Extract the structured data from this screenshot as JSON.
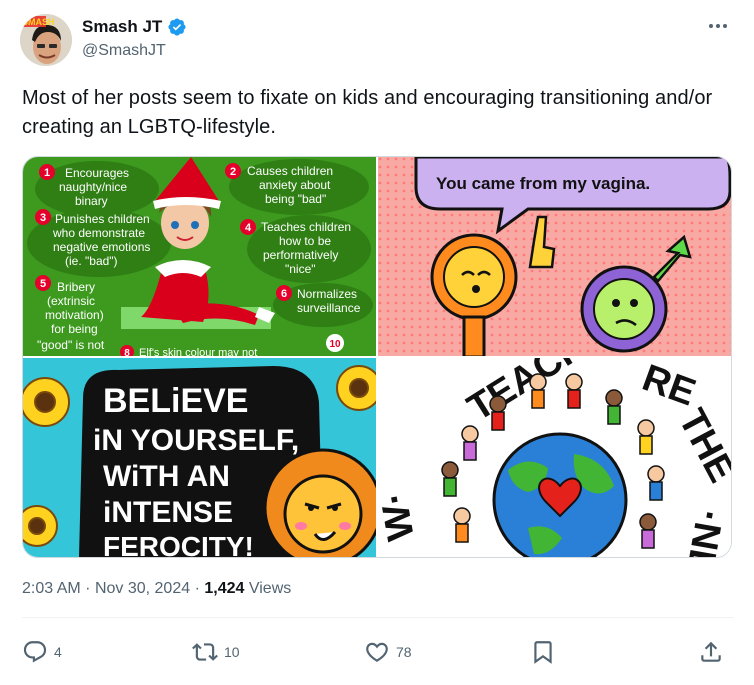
{
  "author": {
    "display_name": "Smash JT",
    "handle": "@SmashJT",
    "avatar_text": "SMASH",
    "verified_color": "#1d9bf0"
  },
  "tweet": {
    "text": "Most of her posts seem to fixate on kids and encouraging transitioning and/or creating an LGBTQ-lifestyle."
  },
  "media": {
    "top_left": {
      "items": [
        {
          "num": "1",
          "text": "Encourages\nnaughty/nice\nbinary"
        },
        {
          "num": "2",
          "text": "Causes children\nanxiety about\nbeing \"bad\""
        },
        {
          "num": "3",
          "text": "Punishes children\nwho demonstrate\nnegative emotions\n(ie. \"bad\")"
        },
        {
          "num": "4",
          "text": "Teaches children\nhow to be\nperformatively\n\"nice\""
        },
        {
          "num": "5",
          "text": "Bribery\n(extrinsic\nmotivation)\nfor being\n\"good\" is not"
        },
        {
          "num": "6",
          "text": "Normalizes\nsurveillance"
        },
        {
          "num": "8",
          "text": "Elf's skin colour may not"
        },
        {
          "num": "10",
          "text": ""
        }
      ]
    },
    "top_right": {
      "speech": "You came from my vagina."
    },
    "bottom_left": {
      "lines": [
        "BELiEVE",
        "iN YOURSELF,",
        "WiTH AN",
        "iNTENSE",
        "FEROCITY!"
      ]
    },
    "bottom_right": {
      "ring_text": "TEACHERS ARE THE ... WORLD."
    }
  },
  "meta": {
    "time": "2:03 AM",
    "dot": "·",
    "date": "Nov 30, 2024",
    "views_count": "1,424",
    "views_label": "Views"
  },
  "actions": {
    "replies": "4",
    "reposts": "10",
    "likes": "78"
  },
  "icons": [
    "verified-badge-icon",
    "more-icon",
    "reply-icon",
    "repost-icon",
    "like-icon",
    "bookmark-icon",
    "share-icon"
  ],
  "colors": {
    "text": "#0f1419",
    "secondary": "#536471",
    "accent": "#1d9bf0",
    "border": "#cfd9de"
  }
}
